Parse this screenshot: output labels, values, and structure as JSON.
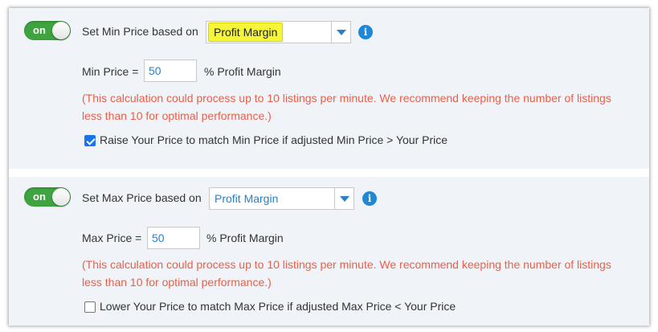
{
  "min_section": {
    "toggle_label": "on",
    "heading_label": "Set Min Price based on",
    "select_value": "Profit Margin",
    "info_glyph": "i",
    "price_label": "Min Price =",
    "price_value": "50",
    "price_suffix": "% Profit Margin",
    "warning_line1": "(This calculation could process up to 10 listings per minute. We recommend keeping the number of listings",
    "warning_line2": "less than 10 for optimal performance.)",
    "checkbox_label": "Raise Your Price to match Min Price if adjusted Min Price > Your Price",
    "checkbox_checked": true
  },
  "max_section": {
    "toggle_label": "on",
    "heading_label": "Set Max Price based on",
    "select_value": "Profit Margin",
    "info_glyph": "i",
    "price_label": "Max Price =",
    "price_value": "50",
    "price_suffix": "% Profit Margin",
    "warning_line1": "(This calculation could process up to 10 listings per minute. We recommend keeping the number of listings",
    "warning_line2": "less than 10 for optimal performance.)",
    "checkbox_label": "Lower Your Price to match Max Price if adjusted Max Price < Your Price",
    "checkbox_checked": false
  },
  "colors": {
    "toggle_on": "#3fa33f",
    "link_blue": "#2a7fc9",
    "warning_red": "#e8604a",
    "highlight_yellow": "#f5f53a",
    "panel_bg": "#f0f4f8"
  }
}
